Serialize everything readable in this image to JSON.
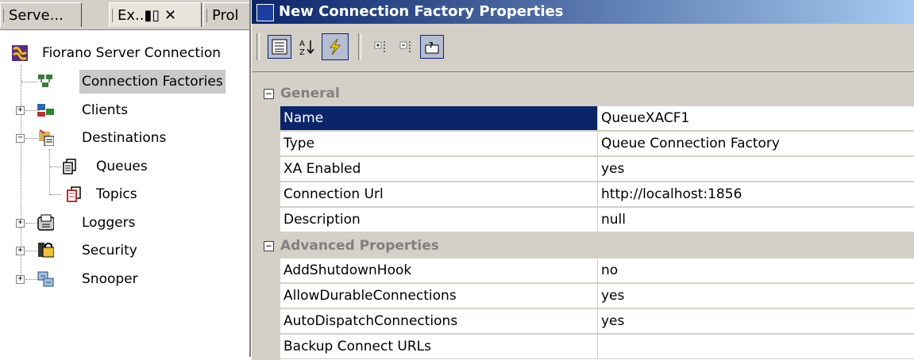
{
  "tabs": [
    {
      "label": "Serve..."
    },
    {
      "label": "Ex..▮▯ ✕"
    },
    {
      "label": "Prol"
    }
  ],
  "tree": {
    "root": "Fiorano Server Connection",
    "items": [
      {
        "label": "Connection Factories",
        "icon": "connection-factories-icon"
      },
      {
        "label": "Clients",
        "icon": "clients-icon"
      },
      {
        "label": "Destinations",
        "icon": "destinations-icon"
      },
      {
        "label": "Queues",
        "icon": "queues-icon"
      },
      {
        "label": "Topics",
        "icon": "topics-icon"
      },
      {
        "label": "Loggers",
        "icon": "loggers-icon"
      },
      {
        "label": "Security",
        "icon": "security-icon"
      },
      {
        "label": "Snooper",
        "icon": "snooper-icon"
      }
    ]
  },
  "panel": {
    "title": "New Connection Factory Properties"
  },
  "toolbar": {
    "buttons": [
      "categorized-view-icon",
      "alphabetical-sort-icon",
      "lightning-icon",
      "expand-all-icon",
      "collapse-all-icon",
      "help-icon"
    ]
  },
  "properties": {
    "general_label": "General",
    "general": [
      {
        "name": "Name",
        "value": "QueueXACF1"
      },
      {
        "name": "Type",
        "value": "Queue Connection Factory"
      },
      {
        "name": "XA Enabled",
        "value": "yes"
      },
      {
        "name": "Connection Url",
        "value": "http://localhost:1856"
      },
      {
        "name": "Description",
        "value": "null"
      }
    ],
    "advanced_label": "Advanced Properties",
    "advanced": [
      {
        "name": "AddShutdownHook",
        "value": "no"
      },
      {
        "name": "AllowDurableConnections",
        "value": "yes"
      },
      {
        "name": "AutoDispatchConnections",
        "value": "yes"
      },
      {
        "name": "Backup Connect URLs",
        "value": ""
      }
    ]
  },
  "colors": {
    "selection": "#0a246a",
    "chrome": "#d4d0c8"
  }
}
